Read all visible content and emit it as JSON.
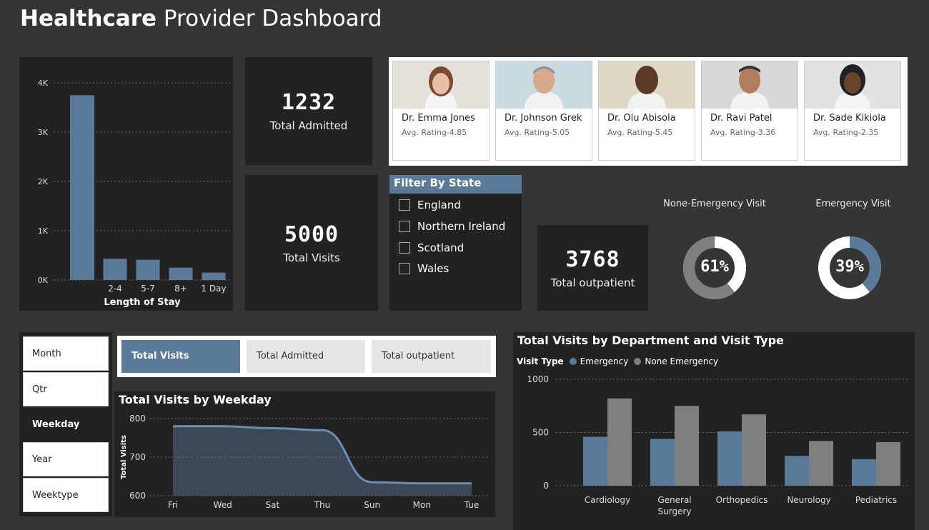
{
  "header": {
    "title_bold": "Healthcare",
    "title_rest": "Provider Dashboard"
  },
  "kpis": {
    "admitted": {
      "value": "1232",
      "label": "Total Admitted"
    },
    "visits": {
      "value": "5000",
      "label": "Total Visits"
    },
    "outpatient": {
      "value": "3768",
      "label": "Total outpatient"
    }
  },
  "doctors": [
    {
      "name": "Dr. Emma Jones",
      "rating": "Avg. Rating-4.85"
    },
    {
      "name": "Dr. Johnson Grek",
      "rating": "Avg. Rating-5.05"
    },
    {
      "name": "Dr. Olu Abisola",
      "rating": "Avg. Rating-5.45"
    },
    {
      "name": "Dr. Ravi Patel",
      "rating": "Avg. Rating-3.36"
    },
    {
      "name": "Dr. Sade Kikiola",
      "rating": "Avg. Rating-2.35"
    }
  ],
  "filter": {
    "title": "Filter By State",
    "options": [
      "England",
      "Northern Ireland",
      "Scotland",
      "Wales"
    ]
  },
  "gauges": [
    {
      "title": "None-Emergency Visit",
      "value": "61%",
      "percent": 61,
      "color": "#7f7f7f"
    },
    {
      "title": "Emergency Visit",
      "value": "39%",
      "percent": 39,
      "color": "#5a7a9a"
    }
  ],
  "period_buttons": [
    "Month",
    "Qtr",
    "Weekday",
    "Year",
    "Weektype"
  ],
  "period_selected": "Weekday",
  "metric_tabs": [
    "Total Visits",
    "Total Admitted",
    "Total outpatient"
  ],
  "metric_selected": "Total Visits",
  "colors": {
    "accent": "#5a7a9a",
    "grey": "#7f7f7f",
    "panel": "#222222",
    "background": "#353535"
  },
  "chart_data": [
    {
      "type": "bar",
      "title": "",
      "xlabel": "Length of Stay",
      "ylabel": "",
      "categories": [
        "",
        "2-4",
        "5-7",
        "8+",
        "1 Day"
      ],
      "values": [
        3750,
        430,
        410,
        250,
        150
      ],
      "ylim": [
        0,
        4000
      ],
      "yticks": [
        "0K",
        "1K",
        "2K",
        "3K",
        "4K"
      ],
      "grid": true
    },
    {
      "type": "area",
      "title": "Total Visits by Weekday",
      "xlabel": "",
      "ylabel": "Total Visits",
      "categories": [
        "Fri",
        "Wed",
        "Sat",
        "Thu",
        "Sun",
        "Mon",
        "Tue"
      ],
      "values": [
        780,
        780,
        775,
        770,
        635,
        632,
        632
      ],
      "ylim": [
        600,
        800
      ],
      "yticks": [
        "600",
        "700",
        "800"
      ],
      "grid": true
    },
    {
      "type": "bar",
      "title": "Total Visits by Department and Visit Type",
      "legend_title": "Visit Type",
      "categories": [
        "Cardiology",
        "General Surgery",
        "Orthopedics",
        "Neurology",
        "Pediatrics"
      ],
      "series": [
        {
          "name": "Emergency",
          "values": [
            460,
            440,
            510,
            280,
            250
          ]
        },
        {
          "name": "None Emergency",
          "values": [
            820,
            750,
            670,
            420,
            410
          ]
        }
      ],
      "ylim": [
        0,
        1000
      ],
      "yticks": [
        "0",
        "500",
        "1000"
      ],
      "legend": "top-left",
      "grid": true
    }
  ]
}
